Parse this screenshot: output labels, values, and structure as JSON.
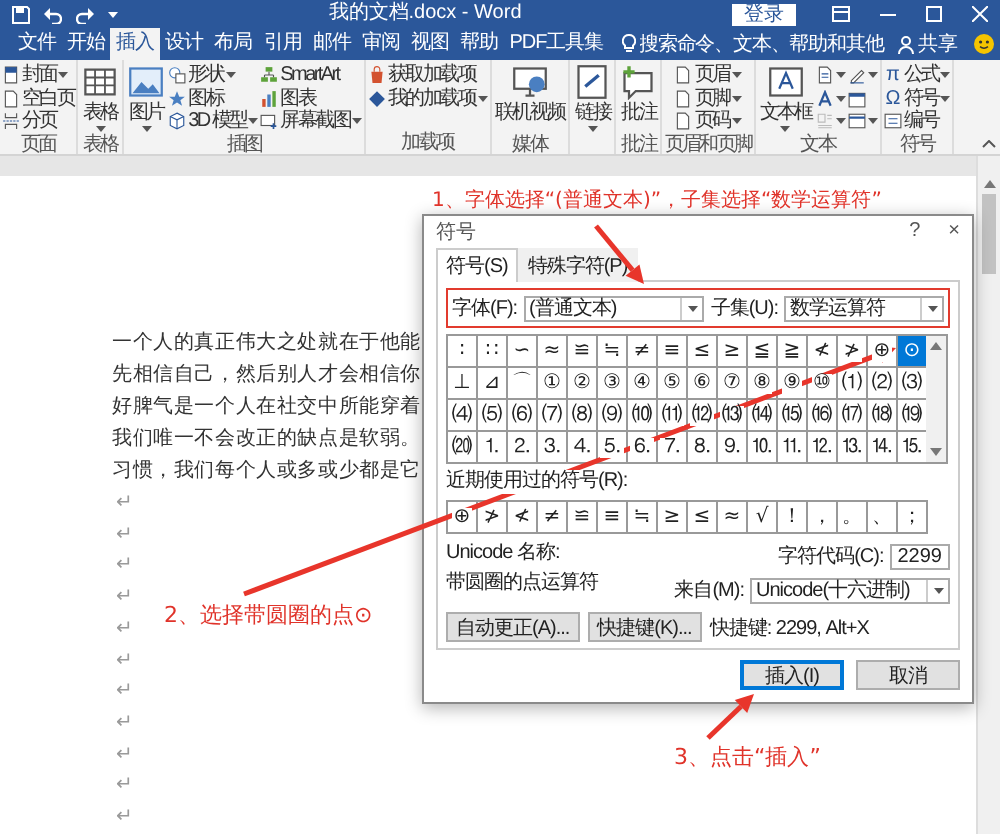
{
  "window": {
    "title": "我的文档.docx - Word",
    "sign_in": "登录"
  },
  "tabs": [
    {
      "label": "文件",
      "selected": false
    },
    {
      "label": "开始",
      "selected": false
    },
    {
      "label": "插入",
      "selected": true
    },
    {
      "label": "设计",
      "selected": false
    },
    {
      "label": "布局",
      "selected": false
    },
    {
      "label": "引用",
      "selected": false
    },
    {
      "label": "邮件",
      "selected": false
    },
    {
      "label": "审阅",
      "selected": false
    },
    {
      "label": "视图",
      "selected": false
    },
    {
      "label": "帮助",
      "selected": false
    },
    {
      "label": "PDF工具集",
      "selected": false
    }
  ],
  "tell_me": {
    "placeholder": "搜索命令、文本、帮助和其他"
  },
  "share": "共享",
  "ribbon": {
    "groups": [
      {
        "label": "页面",
        "columns": [
          [
            {
              "kind": "small",
              "label": "封面",
              "dropdown": true
            },
            {
              "kind": "small",
              "label": "空白页",
              "dropdown": false
            },
            {
              "kind": "small",
              "label": "分页",
              "dropdown": false
            }
          ]
        ]
      },
      {
        "label": "表格",
        "columns": [
          [
            {
              "kind": "large",
              "label": "表格",
              "dropdown": true
            }
          ]
        ]
      },
      {
        "label": "插图",
        "columns": [
          [
            {
              "kind": "large",
              "label": "图片",
              "dropdown": true
            }
          ],
          [
            {
              "kind": "small",
              "label": "形状",
              "dropdown": true
            },
            {
              "kind": "small",
              "label": "图标",
              "dropdown": false
            },
            {
              "kind": "small",
              "label": "3D 模型",
              "dropdown": true
            }
          ],
          [
            {
              "kind": "small",
              "label": "SmartArt",
              "dropdown": false
            },
            {
              "kind": "small",
              "label": "图表",
              "dropdown": false
            },
            {
              "kind": "small",
              "label": "屏幕截图",
              "dropdown": true
            }
          ]
        ]
      },
      {
        "label": "加载项",
        "columns": [
          [
            {
              "kind": "small",
              "label": "获取加载项",
              "dropdown": false
            },
            {
              "kind": "small",
              "label": "我的加载项",
              "dropdown": true
            }
          ]
        ]
      },
      {
        "label": "媒体",
        "columns": [
          [
            {
              "kind": "large",
              "label": "联机视频",
              "dropdown": false
            }
          ]
        ]
      },
      {
        "columns": [
          [
            {
              "kind": "large",
              "label": "链接",
              "dropdown": true
            }
          ]
        ]
      },
      {
        "label": "批注",
        "columns": [
          [
            {
              "kind": "large",
              "label": "批注",
              "dropdown": false
            }
          ]
        ]
      },
      {
        "label": "页眉和页脚",
        "columns": [
          [
            {
              "kind": "small",
              "label": "页眉",
              "dropdown": true
            },
            {
              "kind": "small",
              "label": "页脚",
              "dropdown": true
            },
            {
              "kind": "small",
              "label": "页码",
              "dropdown": true
            }
          ]
        ]
      },
      {
        "label": "文本",
        "columns": [
          [
            {
              "kind": "large",
              "label": "文本框",
              "dropdown": true
            }
          ],
          [
            {
              "kind": "icon",
              "dropdown": true
            },
            {
              "kind": "icon",
              "dropdown": true
            },
            {
              "kind": "icon",
              "dropdown": true
            }
          ],
          [
            {
              "kind": "icon",
              "dropdown": true
            },
            {
              "kind": "icon",
              "dropdown": false
            },
            {
              "kind": "icon",
              "dropdown": true
            }
          ]
        ]
      },
      {
        "label": "符号",
        "columns": [
          [
            {
              "kind": "glyph",
              "glyph": "π",
              "label": "公式",
              "dropdown": true
            },
            {
              "kind": "glyph",
              "glyph": "Ω",
              "label": "符号",
              "dropdown": true
            },
            {
              "kind": "small",
              "label": "编号",
              "dropdown": false
            }
          ]
        ]
      }
    ]
  },
  "document": {
    "text_lines": [
      "一个人的真正伟大之处就在于他能",
      "先相信自己，然后别人才会相信你",
      "好脾气是一个人在社交中所能穿着",
      "我们唯一不会改正的缺点是软弱。",
      "习惯，我们每个人或多或少都是它"
    ],
    "paragraph_marks": [
      "↵",
      "↵",
      "↵",
      "↵",
      "↵",
      "↵",
      "↵",
      "↵",
      "↵",
      "↵",
      "↵"
    ]
  },
  "dialog": {
    "title": "符号",
    "help": "?",
    "close": "×",
    "tabs": [
      {
        "label": "符号(S)",
        "selected": true
      },
      {
        "label": "特殊字符(P)",
        "selected": false
      }
    ],
    "font": {
      "label": "字体(F):",
      "value": "(普通文本)"
    },
    "subset": {
      "label": "子集(U):",
      "value": "数学运算符"
    },
    "symbol_rows": [
      [
        {
          "symbol": "∶",
          "selected": false
        },
        {
          "symbol": "∷",
          "selected": false
        },
        {
          "symbol": "∽",
          "selected": false
        },
        {
          "symbol": "≈",
          "selected": false
        },
        {
          "symbol": "≌",
          "selected": false
        },
        {
          "symbol": "≒",
          "selected": false
        },
        {
          "symbol": "≠",
          "selected": false
        },
        {
          "symbol": "≡",
          "selected": false
        },
        {
          "symbol": "≤",
          "selected": false
        },
        {
          "symbol": "≥",
          "selected": false
        },
        {
          "symbol": "≦",
          "selected": false
        },
        {
          "symbol": "≧",
          "selected": false
        },
        {
          "symbol": "≮",
          "selected": false
        },
        {
          "symbol": "≯",
          "selected": false
        },
        {
          "symbol": "⊕",
          "selected": false
        },
        {
          "symbol": "⊙",
          "selected": true
        }
      ],
      [
        {
          "symbol": "⊥",
          "selected": false
        },
        {
          "symbol": "⊿",
          "selected": false
        },
        {
          "symbol": "⌒",
          "selected": false
        },
        {
          "symbol": "①",
          "selected": false
        },
        {
          "symbol": "②",
          "selected": false
        },
        {
          "symbol": "③",
          "selected": false
        },
        {
          "symbol": "④",
          "selected": false
        },
        {
          "symbol": "⑤",
          "selected": false
        },
        {
          "symbol": "⑥",
          "selected": false
        },
        {
          "symbol": "⑦",
          "selected": false
        },
        {
          "symbol": "⑧",
          "selected": false
        },
        {
          "symbol": "⑨",
          "selected": false
        },
        {
          "symbol": "⑩",
          "selected": false
        },
        {
          "symbol": "⑴",
          "selected": false
        },
        {
          "symbol": "⑵",
          "selected": false
        },
        {
          "symbol": "⑶",
          "selected": false
        }
      ],
      [
        {
          "symbol": "⑷",
          "selected": false
        },
        {
          "symbol": "⑸",
          "selected": false
        },
        {
          "symbol": "⑹",
          "selected": false
        },
        {
          "symbol": "⑺",
          "selected": false
        },
        {
          "symbol": "⑻",
          "selected": false
        },
        {
          "symbol": "⑼",
          "selected": false
        },
        {
          "symbol": "⑽",
          "selected": false
        },
        {
          "symbol": "⑾",
          "selected": false
        },
        {
          "symbol": "⑿",
          "selected": false
        },
        {
          "symbol": "⒀",
          "selected": false
        },
        {
          "symbol": "⒁",
          "selected": false
        },
        {
          "symbol": "⒂",
          "selected": false
        },
        {
          "symbol": "⒃",
          "selected": false
        },
        {
          "symbol": "⒄",
          "selected": false
        },
        {
          "symbol": "⒅",
          "selected": false
        },
        {
          "symbol": "⒆",
          "selected": false
        }
      ],
      [
        {
          "symbol": "⒇",
          "selected": false
        },
        {
          "symbol": "⒈",
          "selected": false
        },
        {
          "symbol": "⒉",
          "selected": false
        },
        {
          "symbol": "⒊",
          "selected": false
        },
        {
          "symbol": "⒋",
          "selected": false
        },
        {
          "symbol": "⒌",
          "selected": false
        },
        {
          "symbol": "⒍",
          "selected": false
        },
        {
          "symbol": "⒎",
          "selected": false
        },
        {
          "symbol": "⒏",
          "selected": false
        },
        {
          "symbol": "⒐",
          "selected": false
        },
        {
          "symbol": "⒑",
          "selected": false
        },
        {
          "symbol": "⒒",
          "selected": false
        },
        {
          "symbol": "⒓",
          "selected": false
        },
        {
          "symbol": "⒔",
          "selected": false
        },
        {
          "symbol": "⒕",
          "selected": false
        },
        {
          "symbol": "⒖",
          "selected": false
        }
      ]
    ],
    "recent_label": "近期使用过的符号(R):",
    "recent_symbols": [
      "⊕",
      "≯",
      "≮",
      "≠",
      "≌",
      "≡",
      "≒",
      "≥",
      "≤",
      "≈",
      "√",
      "！",
      "，",
      "。",
      "、",
      "；"
    ],
    "unicode_name_label": "Unicode 名称:",
    "unicode_name": "带圆圈的点运算符",
    "char_code": {
      "label": "字符代码(C):",
      "value": "2299"
    },
    "from": {
      "label": "来自(M):",
      "value": "Unicode(十六进制)"
    },
    "buttons": [
      "自动更正(A)...",
      "快捷键(K)..."
    ],
    "shortcut_text": "快捷键: 2299, Alt+X",
    "insert_button": "插入(I)",
    "cancel_button": "取消"
  },
  "annotations": [
    {
      "text": "1、字体选择“(普通文本)”，子集选择“数学运算符”"
    },
    {
      "text": "2、选择带圆圈的点⊙"
    },
    {
      "text": "3、点击“插入”"
    }
  ]
}
